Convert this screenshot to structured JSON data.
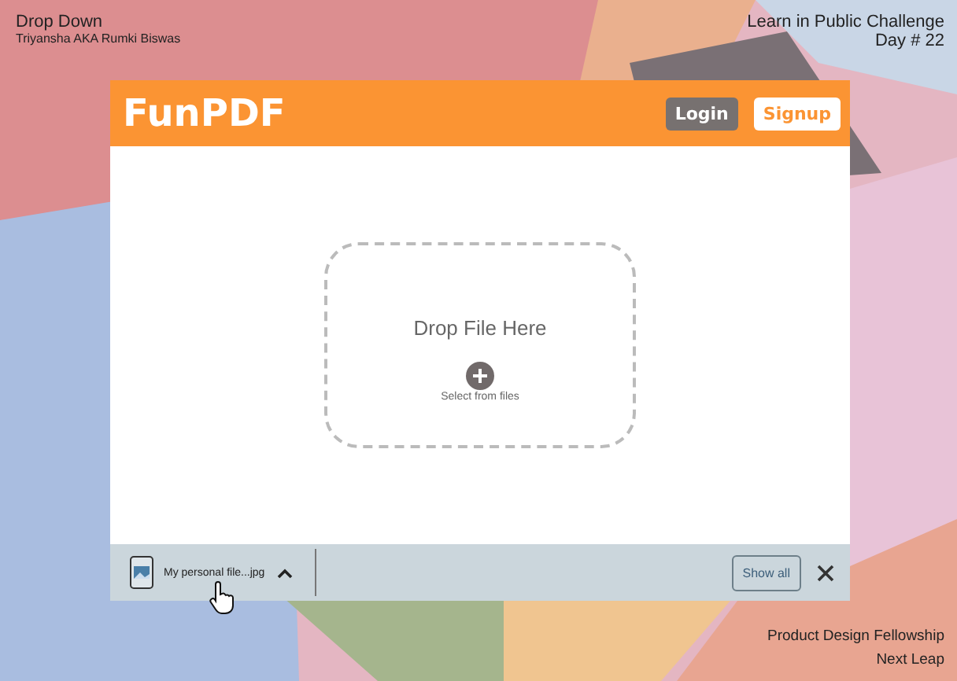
{
  "caption": {
    "title": "Drop Down",
    "author": "Triyansha AKA Rumki Biswas",
    "challenge": "Learn in Public Challenge",
    "day": "Day # 22",
    "program": "Product Design Fellowship",
    "org": "Next Leap"
  },
  "app": {
    "logo": "FunPDF",
    "buttons": [
      {
        "label": "Login",
        "kind": "dark"
      },
      {
        "label": "Signup",
        "kind": "light"
      }
    ]
  },
  "dropzone": {
    "title": "Drop File Here",
    "action": "Select from files"
  },
  "download_bar": {
    "file_name": "My personal file...jpg",
    "show_all": "Show all"
  }
}
